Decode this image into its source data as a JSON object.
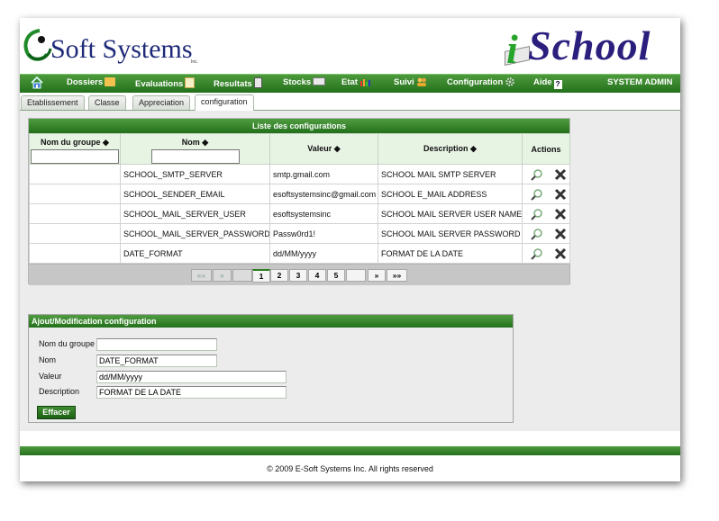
{
  "brand": {
    "company": "Soft Systems",
    "company_suffix": "Inc.",
    "product_prefix": "i",
    "product_name": "School"
  },
  "menu": [
    {
      "label": "Dossiers",
      "icon": "folder-icon"
    },
    {
      "label": "Evaluations",
      "icon": "pencil-icon"
    },
    {
      "label": "Resultats",
      "icon": "report-icon"
    },
    {
      "label": "Stocks",
      "icon": "envelope-icon"
    },
    {
      "label": "Etat",
      "icon": "bar-chart-icon"
    },
    {
      "label": "Suivi",
      "icon": "users-icon"
    },
    {
      "label": "Configuration",
      "icon": "gear-icon"
    },
    {
      "label": "Aide",
      "icon": "help-icon"
    }
  ],
  "user": {
    "label": "SYSTEM ADMIN"
  },
  "tabs": [
    {
      "label": "Etablissement",
      "active": false
    },
    {
      "label": "Classe",
      "active": false
    },
    {
      "label": "Appreciation",
      "active": false
    },
    {
      "label": "configuration",
      "active": true
    }
  ],
  "grid": {
    "title": "Liste des configurations",
    "columns": [
      {
        "label": "Nom du groupe ◆",
        "filter": true
      },
      {
        "label": "Nom ◆",
        "filter": true
      },
      {
        "label": "Valeur ◆",
        "filter": false
      },
      {
        "label": "Description ◆",
        "filter": false
      },
      {
        "label": "Actions",
        "filter": false
      }
    ],
    "rows": [
      {
        "group": "",
        "name": "SCHOOL_SMTP_SERVER",
        "value": "smtp.gmail.com",
        "description": "SCHOOL MAIL SMTP SERVER"
      },
      {
        "group": "",
        "name": "SCHOOL_SENDER_EMAIL",
        "value": "esoftsystemsinc@gmail.com",
        "description": "SCHOOL E_MAIL ADDRESS"
      },
      {
        "group": "",
        "name": "SCHOOL_MAIL_SERVER_USER",
        "value": "esoftsystemsinc",
        "description": "SCHOOL MAIL SERVER USER NAME"
      },
      {
        "group": "",
        "name": "SCHOOL_MAIL_SERVER_PASSWORD",
        "value": "Passw0rd1!",
        "description": "SCHOOL MAIL SERVER PASSWORD"
      },
      {
        "group": "",
        "name": "DATE_FORMAT",
        "value": "dd/MM/yyyy",
        "description": "FORMAT DE LA DATE"
      }
    ],
    "pager": {
      "first": "««",
      "prev": "«",
      "pages": [
        "1",
        "2",
        "3",
        "4",
        "5"
      ],
      "current": "1",
      "next": "»",
      "last": "»»"
    }
  },
  "form": {
    "title": "Ajout/Modification configuration",
    "group_label": "Nom du groupe",
    "group_value": "",
    "name_label": "Nom",
    "name_value": "DATE_FORMAT",
    "value_label": "Valeur",
    "value_value": "dd/MM/yyyy",
    "description_label": "Description",
    "description_value": "FORMAT DE LA DATE",
    "clear_button": "Effacer"
  },
  "footer": {
    "copyright": "© 2009 E-Soft Systems Inc. All rights reserved"
  }
}
